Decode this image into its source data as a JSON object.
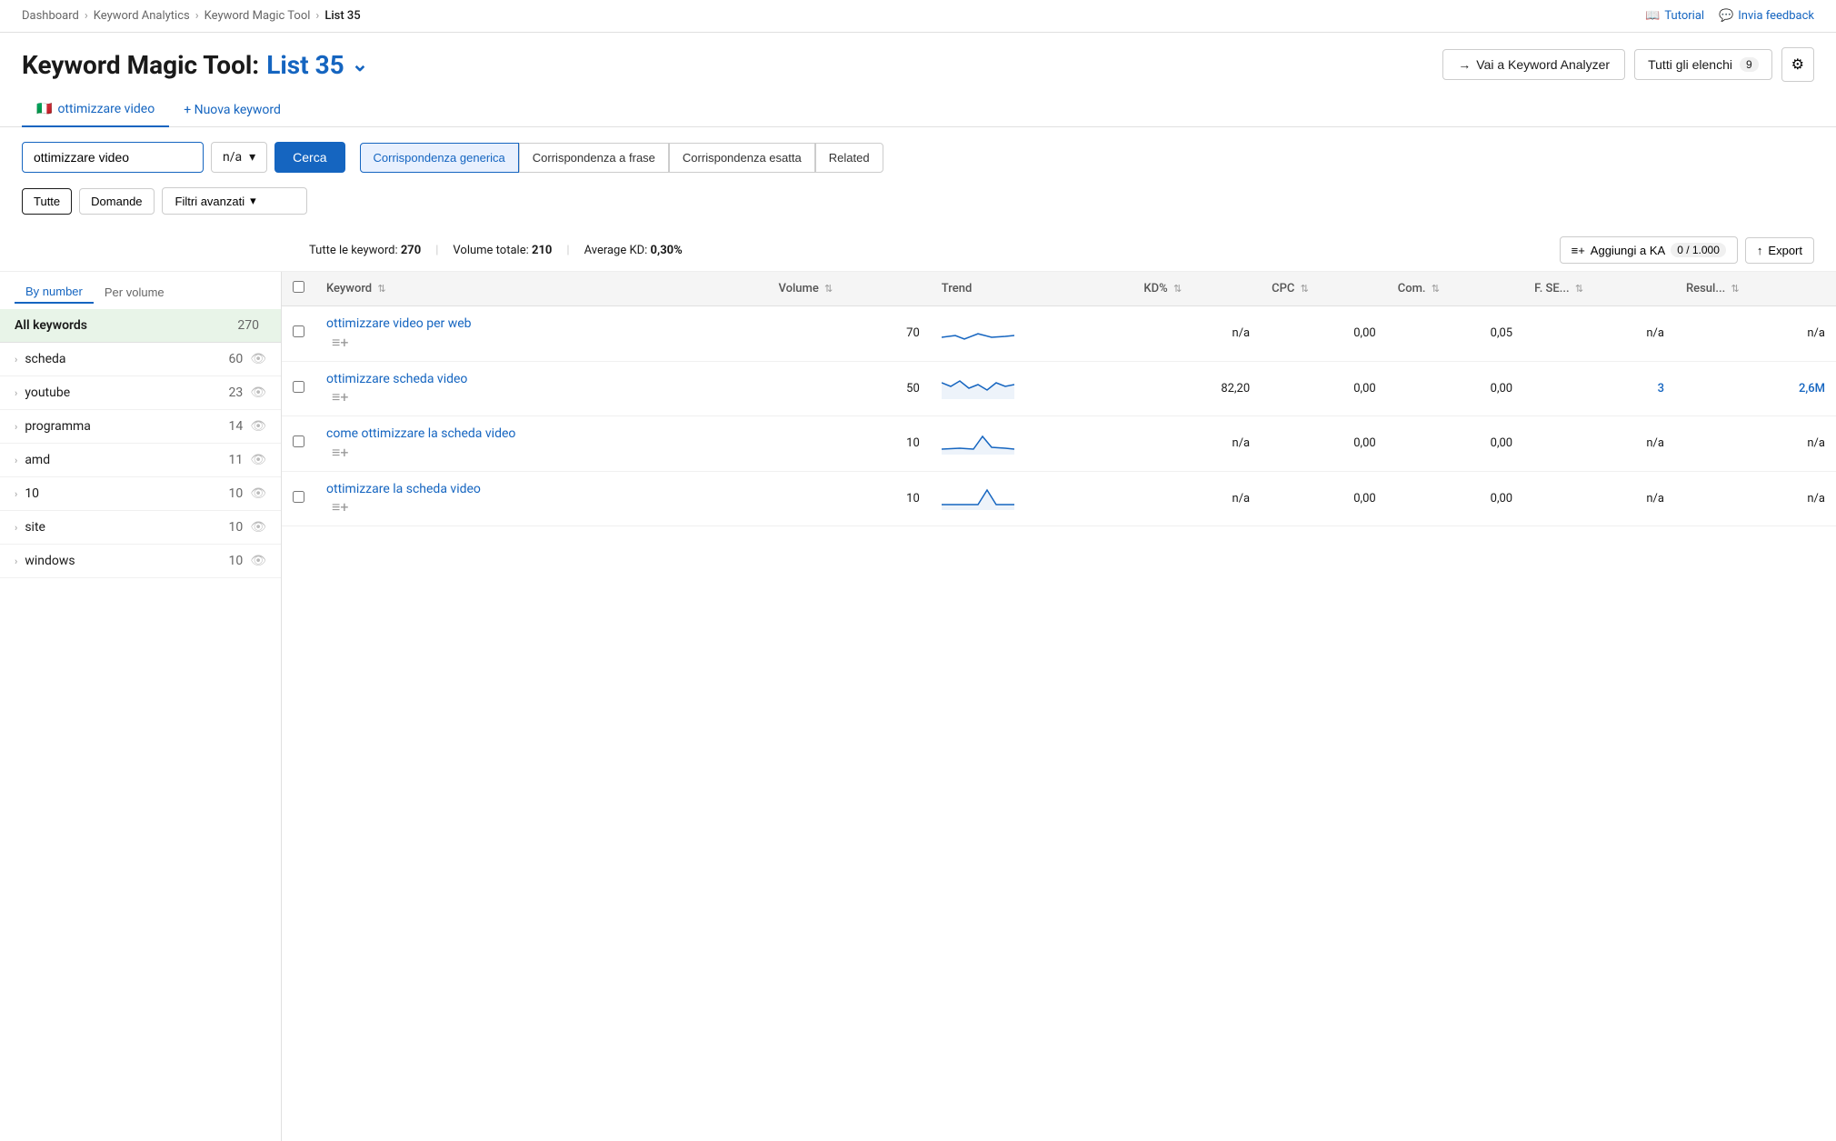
{
  "breadcrumb": {
    "items": [
      "Dashboard",
      "Keyword Analytics",
      "Keyword Magic Tool",
      "List 35"
    ]
  },
  "top_actions": {
    "tutorial_label": "Tutorial",
    "feedback_label": "Invia feedback"
  },
  "page_title": {
    "prefix": "Keyword Magic Tool:",
    "list_name": "List 35"
  },
  "title_buttons": {
    "analyzer": "Vai a Keyword Analyzer",
    "elenchi": "Tutti gli elenchi",
    "elenchi_count": "9"
  },
  "tabs": [
    {
      "label": "ottimizzare video",
      "active": true
    },
    {
      "label": "+ Nuova keyword",
      "active": false
    }
  ],
  "search": {
    "input_value": "ottimizzare video",
    "select_value": "n/a",
    "cerca_label": "Cerca"
  },
  "match_buttons": [
    {
      "label": "Corrispondenza generica",
      "active": true
    },
    {
      "label": "Corrispondenza a frase",
      "active": false
    },
    {
      "label": "Corrispondenza esatta",
      "active": false
    },
    {
      "label": "Related",
      "active": false
    }
  ],
  "filters": {
    "tutte_label": "Tutte",
    "domande_label": "Domande",
    "advanced_label": "Filtri avanzati"
  },
  "sidebar": {
    "sort_options": [
      {
        "label": "By number",
        "active": true
      },
      {
        "label": "Per volume",
        "active": false
      }
    ],
    "all_keywords": {
      "label": "All keywords",
      "count": "270"
    },
    "items": [
      {
        "label": "scheda",
        "count": "60"
      },
      {
        "label": "youtube",
        "count": "23"
      },
      {
        "label": "programma",
        "count": "14"
      },
      {
        "label": "amd",
        "count": "11"
      },
      {
        "label": "10",
        "count": "10"
      },
      {
        "label": "site",
        "count": "10"
      },
      {
        "label": "windows",
        "count": "10"
      }
    ]
  },
  "stats": {
    "keywords_label": "Tutte le keyword:",
    "keywords_count": "270",
    "volume_label": "Volume totale:",
    "volume_count": "210",
    "kd_label": "Average KD:",
    "kd_value": "0,30%",
    "aggiungi_label": "Aggiungi a KA",
    "aggiungi_count": "0 / 1.000",
    "export_label": "Export"
  },
  "table": {
    "columns": [
      "Keyword",
      "Volume",
      "Trend",
      "KD%",
      "CPC",
      "Com.",
      "F. SE...",
      "Resul..."
    ],
    "rows": [
      {
        "keyword": "ottimizzare video per web",
        "volume": "70",
        "kd": "n/a",
        "cpc": "0,00",
        "com": "0,05",
        "fse": "n/a",
        "result": "n/a",
        "trend_type": "low"
      },
      {
        "keyword": "ottimizzare scheda video",
        "volume": "50",
        "kd": "82,20",
        "cpc": "0,00",
        "com": "0,00",
        "fse": "3",
        "result": "2,6M",
        "trend_type": "medium",
        "fse_blue": true,
        "result_blue": true
      },
      {
        "keyword": "come ottimizzare la scheda video",
        "volume": "10",
        "kd": "n/a",
        "cpc": "0,00",
        "com": "0,00",
        "fse": "n/a",
        "result": "n/a",
        "trend_type": "spike"
      },
      {
        "keyword": "ottimizzare la scheda video",
        "volume": "10",
        "kd": "n/a",
        "cpc": "0,00",
        "com": "0,00",
        "fse": "n/a",
        "result": "n/a",
        "trend_type": "single_spike"
      }
    ]
  }
}
